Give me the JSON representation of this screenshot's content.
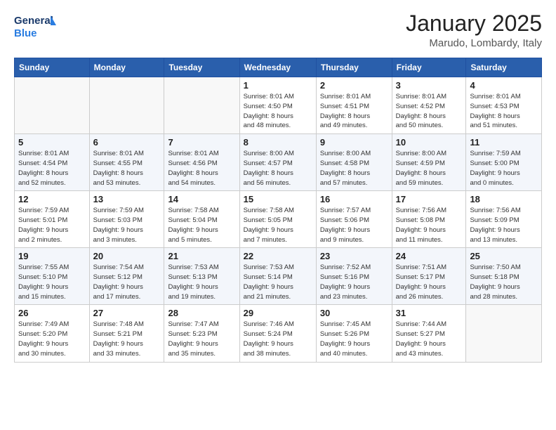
{
  "header": {
    "logo_line1": "General",
    "logo_line2": "Blue",
    "month": "January 2025",
    "location": "Marudo, Lombardy, Italy"
  },
  "weekdays": [
    "Sunday",
    "Monday",
    "Tuesday",
    "Wednesday",
    "Thursday",
    "Friday",
    "Saturday"
  ],
  "weeks": [
    [
      {
        "day": "",
        "info": ""
      },
      {
        "day": "",
        "info": ""
      },
      {
        "day": "",
        "info": ""
      },
      {
        "day": "1",
        "info": "Sunrise: 8:01 AM\nSunset: 4:50 PM\nDaylight: 8 hours\nand 48 minutes."
      },
      {
        "day": "2",
        "info": "Sunrise: 8:01 AM\nSunset: 4:51 PM\nDaylight: 8 hours\nand 49 minutes."
      },
      {
        "day": "3",
        "info": "Sunrise: 8:01 AM\nSunset: 4:52 PM\nDaylight: 8 hours\nand 50 minutes."
      },
      {
        "day": "4",
        "info": "Sunrise: 8:01 AM\nSunset: 4:53 PM\nDaylight: 8 hours\nand 51 minutes."
      }
    ],
    [
      {
        "day": "5",
        "info": "Sunrise: 8:01 AM\nSunset: 4:54 PM\nDaylight: 8 hours\nand 52 minutes."
      },
      {
        "day": "6",
        "info": "Sunrise: 8:01 AM\nSunset: 4:55 PM\nDaylight: 8 hours\nand 53 minutes."
      },
      {
        "day": "7",
        "info": "Sunrise: 8:01 AM\nSunset: 4:56 PM\nDaylight: 8 hours\nand 54 minutes."
      },
      {
        "day": "8",
        "info": "Sunrise: 8:00 AM\nSunset: 4:57 PM\nDaylight: 8 hours\nand 56 minutes."
      },
      {
        "day": "9",
        "info": "Sunrise: 8:00 AM\nSunset: 4:58 PM\nDaylight: 8 hours\nand 57 minutes."
      },
      {
        "day": "10",
        "info": "Sunrise: 8:00 AM\nSunset: 4:59 PM\nDaylight: 8 hours\nand 59 minutes."
      },
      {
        "day": "11",
        "info": "Sunrise: 7:59 AM\nSunset: 5:00 PM\nDaylight: 9 hours\nand 0 minutes."
      }
    ],
    [
      {
        "day": "12",
        "info": "Sunrise: 7:59 AM\nSunset: 5:01 PM\nDaylight: 9 hours\nand 2 minutes."
      },
      {
        "day": "13",
        "info": "Sunrise: 7:59 AM\nSunset: 5:03 PM\nDaylight: 9 hours\nand 3 minutes."
      },
      {
        "day": "14",
        "info": "Sunrise: 7:58 AM\nSunset: 5:04 PM\nDaylight: 9 hours\nand 5 minutes."
      },
      {
        "day": "15",
        "info": "Sunrise: 7:58 AM\nSunset: 5:05 PM\nDaylight: 9 hours\nand 7 minutes."
      },
      {
        "day": "16",
        "info": "Sunrise: 7:57 AM\nSunset: 5:06 PM\nDaylight: 9 hours\nand 9 minutes."
      },
      {
        "day": "17",
        "info": "Sunrise: 7:56 AM\nSunset: 5:08 PM\nDaylight: 9 hours\nand 11 minutes."
      },
      {
        "day": "18",
        "info": "Sunrise: 7:56 AM\nSunset: 5:09 PM\nDaylight: 9 hours\nand 13 minutes."
      }
    ],
    [
      {
        "day": "19",
        "info": "Sunrise: 7:55 AM\nSunset: 5:10 PM\nDaylight: 9 hours\nand 15 minutes."
      },
      {
        "day": "20",
        "info": "Sunrise: 7:54 AM\nSunset: 5:12 PM\nDaylight: 9 hours\nand 17 minutes."
      },
      {
        "day": "21",
        "info": "Sunrise: 7:53 AM\nSunset: 5:13 PM\nDaylight: 9 hours\nand 19 minutes."
      },
      {
        "day": "22",
        "info": "Sunrise: 7:53 AM\nSunset: 5:14 PM\nDaylight: 9 hours\nand 21 minutes."
      },
      {
        "day": "23",
        "info": "Sunrise: 7:52 AM\nSunset: 5:16 PM\nDaylight: 9 hours\nand 23 minutes."
      },
      {
        "day": "24",
        "info": "Sunrise: 7:51 AM\nSunset: 5:17 PM\nDaylight: 9 hours\nand 26 minutes."
      },
      {
        "day": "25",
        "info": "Sunrise: 7:50 AM\nSunset: 5:18 PM\nDaylight: 9 hours\nand 28 minutes."
      }
    ],
    [
      {
        "day": "26",
        "info": "Sunrise: 7:49 AM\nSunset: 5:20 PM\nDaylight: 9 hours\nand 30 minutes."
      },
      {
        "day": "27",
        "info": "Sunrise: 7:48 AM\nSunset: 5:21 PM\nDaylight: 9 hours\nand 33 minutes."
      },
      {
        "day": "28",
        "info": "Sunrise: 7:47 AM\nSunset: 5:23 PM\nDaylight: 9 hours\nand 35 minutes."
      },
      {
        "day": "29",
        "info": "Sunrise: 7:46 AM\nSunset: 5:24 PM\nDaylight: 9 hours\nand 38 minutes."
      },
      {
        "day": "30",
        "info": "Sunrise: 7:45 AM\nSunset: 5:26 PM\nDaylight: 9 hours\nand 40 minutes."
      },
      {
        "day": "31",
        "info": "Sunrise: 7:44 AM\nSunset: 5:27 PM\nDaylight: 9 hours\nand 43 minutes."
      },
      {
        "day": "",
        "info": ""
      }
    ]
  ]
}
